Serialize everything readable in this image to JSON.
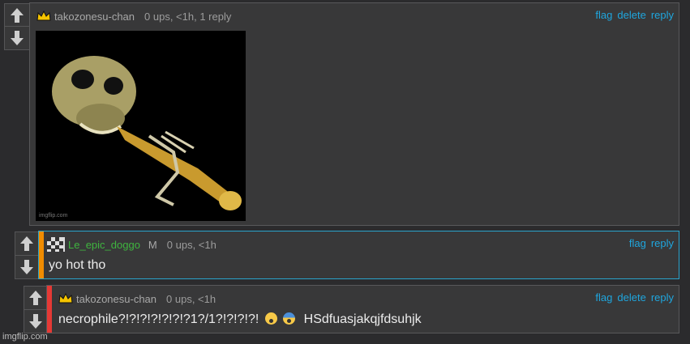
{
  "comments": [
    {
      "username": "takozonesu-chan",
      "meta": "0 ups, <1h, 1 reply",
      "actions": [
        "flag",
        "delete",
        "reply"
      ],
      "image_watermark": "imgflip.com"
    },
    {
      "username": "Le_epic_doggo",
      "mod_badge": "M",
      "meta": "0 ups, <1h",
      "actions": [
        "flag",
        "reply"
      ],
      "text": "yo hot tho",
      "bar_color": "#f08c00"
    },
    {
      "username": "takozonesu-chan",
      "meta": "0 ups, <1h",
      "actions": [
        "flag",
        "delete",
        "reply"
      ],
      "text": "necrophile?!?!?!?!?!?!?1?/1?!?!?!?!",
      "text_suffix": "HSdfuasjakqjfdsuhjk",
      "bar_color": "#e53935"
    }
  ],
  "page_watermark": "imgflip.com",
  "colors": {
    "link": "#1fa6de",
    "username_green": "#3fb43f",
    "background": "#2b2b2d",
    "panel": "#383839"
  }
}
